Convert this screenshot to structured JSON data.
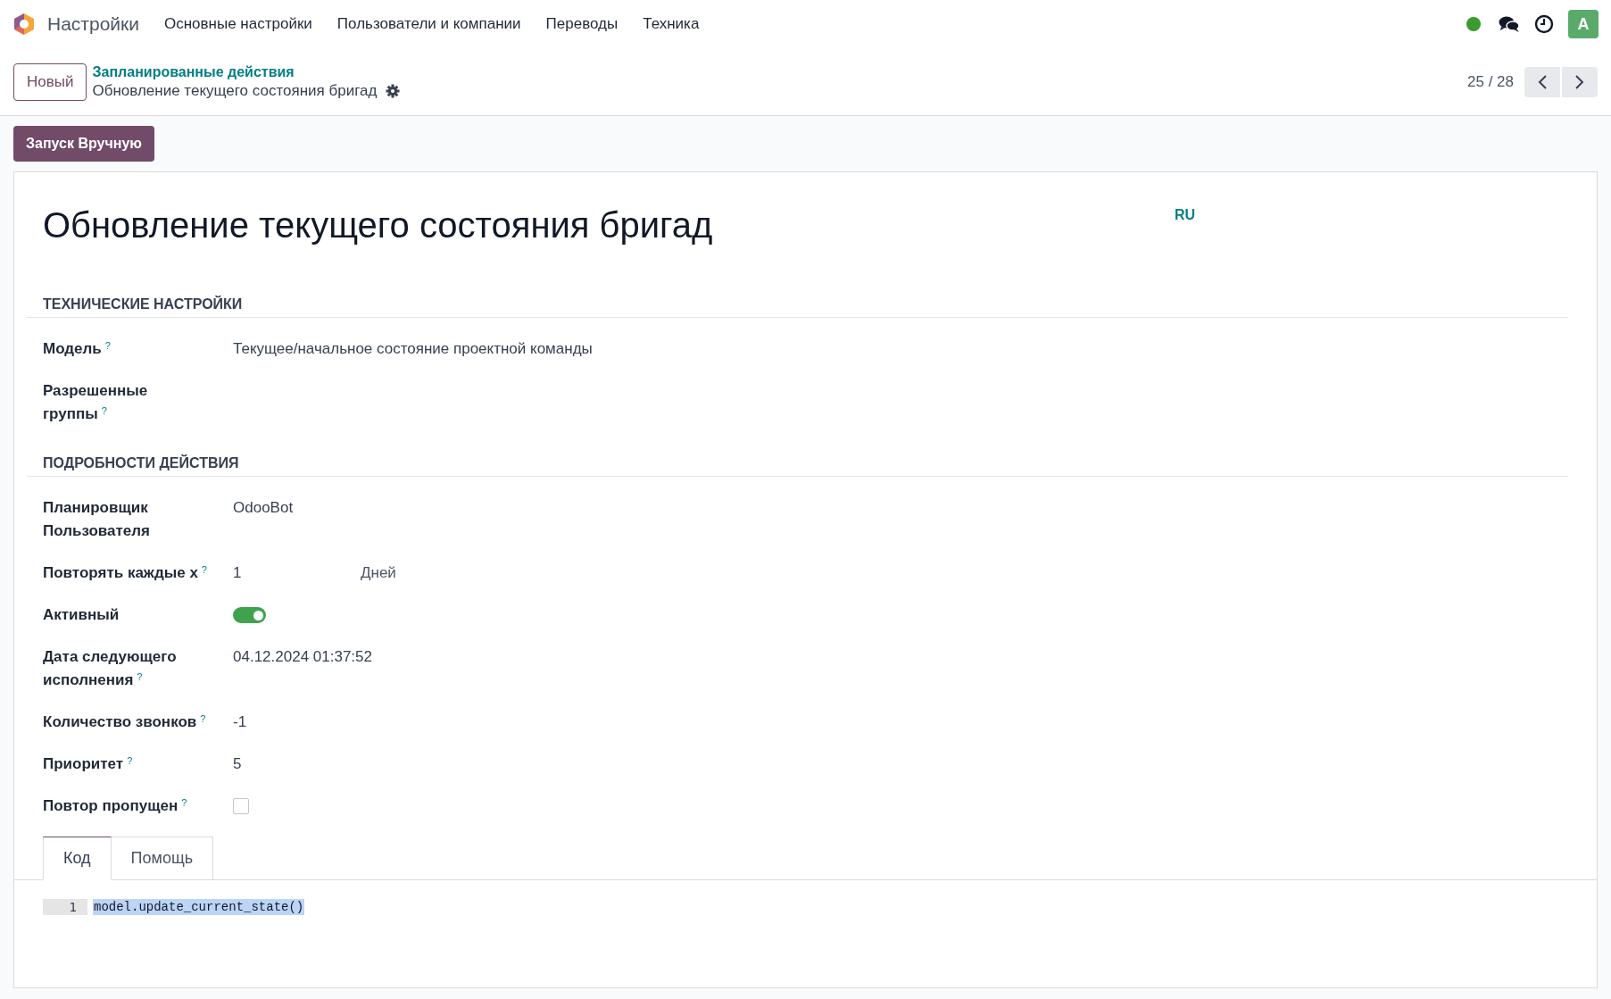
{
  "navbar": {
    "app_name": "Настройки",
    "menu": [
      {
        "label": "Основные настройки"
      },
      {
        "label": "Пользователи и компании"
      },
      {
        "label": "Переводы"
      },
      {
        "label": "Техника"
      }
    ],
    "avatar": "A"
  },
  "control_panel": {
    "new_button": "Новый",
    "breadcrumb_parent": "Запланированные действия",
    "breadcrumb_current": "Обновление текущего состояния бригад",
    "pager": "25 / 28"
  },
  "action_button": "Запуск Вручную",
  "form": {
    "title": "Обновление текущего состояния бригад",
    "language": "RU",
    "sections": [
      {
        "title": "ТЕХНИЧЕСКИЕ НАСТРОЙКИ",
        "fields": [
          {
            "kind": "text",
            "label": "Модель",
            "help": "?",
            "value": "Текущее/начальное состояние проектной команды"
          },
          {
            "kind": "text",
            "label": "Разрешенные группы",
            "help": "?"
          }
        ]
      },
      {
        "title": "ПОДРОБНОСТИ ДЕЙСТВИЯ",
        "fields": [
          {
            "kind": "text",
            "label": "Планировщик Пользователя",
            "value": "OdooBot"
          },
          {
            "kind": "interval",
            "label": "Повторять каждые x",
            "help": "?",
            "value": "1",
            "unit": "Дней"
          },
          {
            "kind": "toggle",
            "label": "Активный",
            "on": true
          },
          {
            "kind": "text",
            "label": "Дата следующего исполнения",
            "help": "?",
            "value": "04.12.2024 01:37:52"
          },
          {
            "kind": "text",
            "label": "Количество звонков",
            "help": "?",
            "value": "-1"
          },
          {
            "kind": "text",
            "label": "Приоритет",
            "help": "?",
            "value": "5"
          },
          {
            "kind": "checkbox",
            "label": "Повтор пропущен",
            "help": "?",
            "checked": false
          }
        ]
      }
    ],
    "tabs": [
      {
        "label": "Код",
        "selected": true
      },
      {
        "label": "Помощь",
        "selected": false
      }
    ],
    "code": [
      {
        "line_number": "1",
        "text": "model.update_current_state()",
        "selected": true
      }
    ]
  }
}
